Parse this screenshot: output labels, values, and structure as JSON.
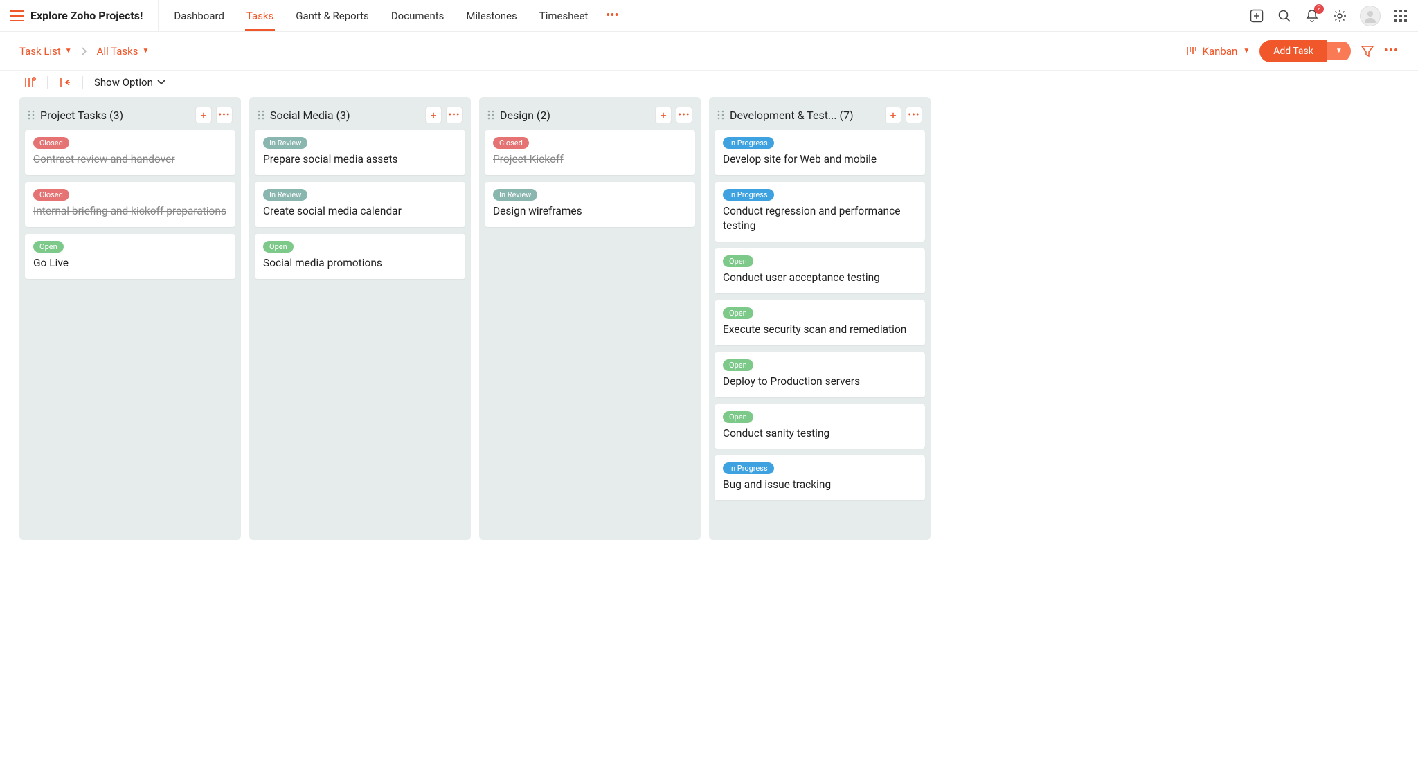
{
  "brand": "Explore Zoho Projects!",
  "nav": {
    "tabs": [
      "Dashboard",
      "Tasks",
      "Gantt & Reports",
      "Documents",
      "Milestones",
      "Timesheet"
    ],
    "active_index": 1
  },
  "notifications": {
    "count": "2"
  },
  "breadcrumb": {
    "task_list": "Task List",
    "current": "All Tasks"
  },
  "view": {
    "label": "Kanban"
  },
  "add_task_label": "Add Task",
  "show_option_label": "Show Option",
  "status_labels": {
    "closed": "Closed",
    "in_review": "In Review",
    "open": "Open",
    "in_progress": "In Progress"
  },
  "columns": [
    {
      "title": "Project Tasks",
      "count": 3,
      "cards": [
        {
          "status": "closed",
          "title": "Contract review and handover",
          "strike": true
        },
        {
          "status": "closed",
          "title": "Internal briefing and kickoff preparations",
          "strike": true
        },
        {
          "status": "open",
          "title": "Go Live",
          "strike": false
        }
      ]
    },
    {
      "title": "Social Media",
      "count": 3,
      "cards": [
        {
          "status": "in_review",
          "title": "Prepare social media assets",
          "strike": false
        },
        {
          "status": "in_review",
          "title": "Create social media calendar",
          "strike": false
        },
        {
          "status": "open",
          "title": "Social media promotions",
          "strike": false
        }
      ]
    },
    {
      "title": "Design",
      "count": 2,
      "cards": [
        {
          "status": "closed",
          "title": "Project Kickoff",
          "strike": true
        },
        {
          "status": "in_review",
          "title": "Design wireframes",
          "strike": false
        }
      ]
    },
    {
      "title": "Development & Test...",
      "count": 7,
      "cards": [
        {
          "status": "in_progress",
          "title": "Develop site for Web and mobile",
          "strike": false
        },
        {
          "status": "in_progress",
          "title": "Conduct regression and performance testing",
          "strike": false
        },
        {
          "status": "open",
          "title": "Conduct user acceptance testing",
          "strike": false
        },
        {
          "status": "open",
          "title": "Execute security scan and remediation",
          "strike": false
        },
        {
          "status": "open",
          "title": "Deploy to Production servers",
          "strike": false
        },
        {
          "status": "open",
          "title": "Conduct sanity testing",
          "strike": false
        },
        {
          "status": "in_progress",
          "title": "Bug and issue tracking",
          "strike": false
        }
      ]
    }
  ]
}
